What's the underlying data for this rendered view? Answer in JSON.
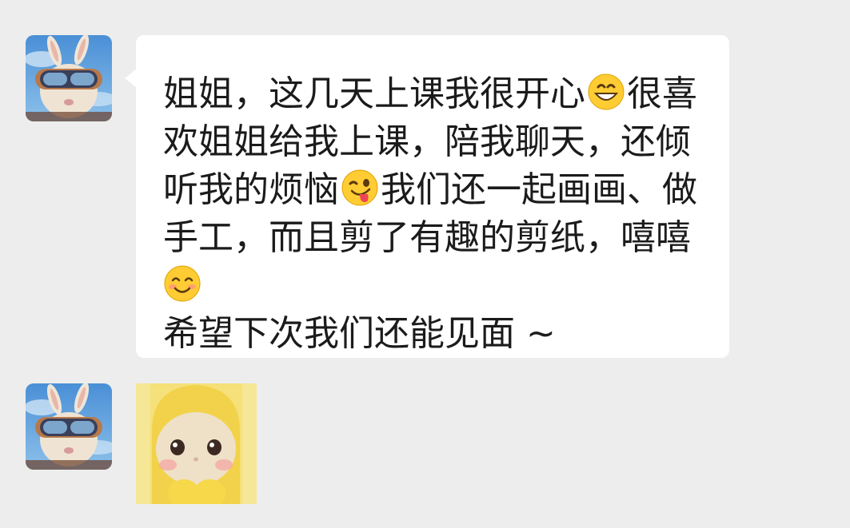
{
  "messages": [
    {
      "type": "text",
      "avatar": "rabbit-goggles-avatar",
      "lines": [
        {
          "a": "姐姐，这几天上课我很开心",
          "emoji": "grinning-face-emoji",
          "b": "很喜"
        },
        {
          "a": "欢姐姐给我上课，陪我聊天，还倾"
        },
        {
          "a": "听我的烦恼",
          "emoji": "winking-tongue-emoji",
          "b": "我们还一起画画、做"
        },
        {
          "a": "手工，而且剪了有趣的剪纸，嘻嘻"
        },
        {
          "emoji": "smiling-face-emoji"
        },
        {
          "a": "希望下次我们还能见面 ~"
        }
      ]
    },
    {
      "type": "sticker",
      "avatar": "rabbit-goggles-avatar",
      "sticker": "yellow-teletubby-baby-sticker"
    }
  ],
  "colors": {
    "background": "#ededed",
    "bubble": "#ffffff",
    "text": "#1b1b1b"
  }
}
